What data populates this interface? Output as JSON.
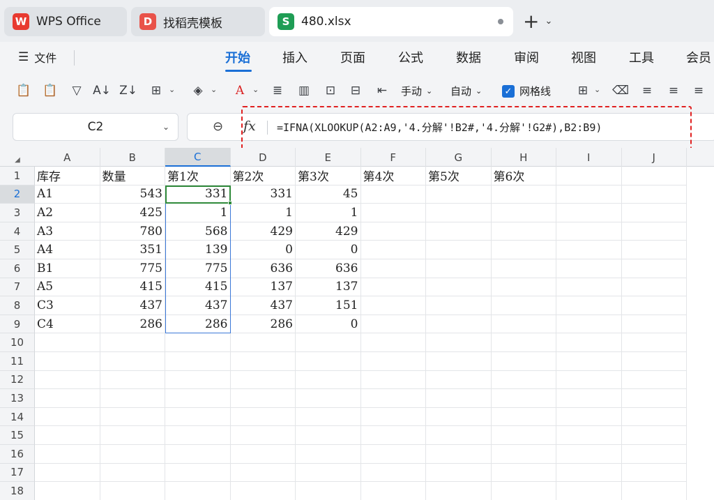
{
  "tabs": [
    {
      "label": "WPS Office",
      "logo": "W",
      "logo_color": "#e83a30"
    },
    {
      "label": "找稻壳模板",
      "logo": "D",
      "logo_color": "#e9534a"
    },
    {
      "label": "480.xlsx",
      "logo": "S",
      "logo_color": "#1f9d55"
    }
  ],
  "menu": {
    "file_label": "文件",
    "items": [
      "开始",
      "插入",
      "页面",
      "公式",
      "数据",
      "审阅",
      "视图",
      "工具",
      "会员"
    ]
  },
  "toolbar": {
    "manual_label": "手动",
    "auto_label": "自动",
    "gridlines_label": "网格线"
  },
  "formula_bar": {
    "cell_ref": "C2",
    "formula": "=IFNA(XLOOKUP(A2:A9,'4.分解'!B2#,'4.分解'!G2#),B2:B9)"
  },
  "columns": [
    "A",
    "B",
    "C",
    "D",
    "E",
    "F",
    "G",
    "H",
    "I",
    "J"
  ],
  "rows": [
    "1",
    "2",
    "3",
    "4",
    "5",
    "6",
    "7",
    "8",
    "9",
    "10",
    "11",
    "12",
    "13",
    "14",
    "15",
    "16",
    "17",
    "18"
  ],
  "cells": [
    [
      "库存",
      "数量",
      "第1次",
      "第2次",
      "第3次",
      "第4次",
      "第5次",
      "第6次"
    ],
    [
      "A1",
      "543",
      "331",
      "331",
      "45"
    ],
    [
      "A2",
      "425",
      "1",
      "1",
      "1"
    ],
    [
      "A3",
      "780",
      "568",
      "429",
      "429"
    ],
    [
      "A4",
      "351",
      "139",
      "0",
      "0"
    ],
    [
      "B1",
      "775",
      "775",
      "636",
      "636"
    ],
    [
      "A5",
      "415",
      "415",
      "137",
      "137"
    ],
    [
      "C3",
      "437",
      "437",
      "437",
      "151"
    ],
    [
      "C4",
      "286",
      "286",
      "286",
      "0"
    ]
  ],
  "colors": {
    "accent": "#1a6fd6",
    "active_cell": "#2f8a3a",
    "annotation": "#e02020"
  }
}
